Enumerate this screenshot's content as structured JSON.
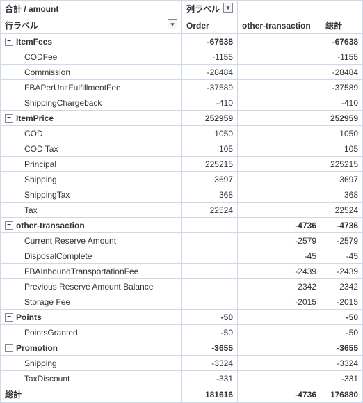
{
  "header": {
    "topLeft": "合計 / amount",
    "colLabelsTitle": "列ラベル",
    "rowLabelsTitle": "行ラベル",
    "col1": "Order",
    "col2": "other-transaction",
    "col3": "総計"
  },
  "groups": [
    {
      "label": "ItemFees",
      "order": "-67638",
      "other": "",
      "total": "-67638",
      "children": [
        {
          "label": "CODFee",
          "order": "-1155",
          "other": "",
          "total": "-1155"
        },
        {
          "label": "Commission",
          "order": "-28484",
          "other": "",
          "total": "-28484"
        },
        {
          "label": "FBAPerUnitFulfillmentFee",
          "order": "-37589",
          "other": "",
          "total": "-37589"
        },
        {
          "label": "ShippingChargeback",
          "order": "-410",
          "other": "",
          "total": "-410"
        }
      ]
    },
    {
      "label": "ItemPrice",
      "order": "252959",
      "other": "",
      "total": "252959",
      "children": [
        {
          "label": "COD",
          "order": "1050",
          "other": "",
          "total": "1050"
        },
        {
          "label": "COD Tax",
          "order": "105",
          "other": "",
          "total": "105"
        },
        {
          "label": "Principal",
          "order": "225215",
          "other": "",
          "total": "225215"
        },
        {
          "label": "Shipping",
          "order": "3697",
          "other": "",
          "total": "3697"
        },
        {
          "label": "ShippingTax",
          "order": "368",
          "other": "",
          "total": "368"
        },
        {
          "label": "Tax",
          "order": "22524",
          "other": "",
          "total": "22524"
        }
      ]
    },
    {
      "label": "other-transaction",
      "order": "",
      "other": "-4736",
      "total": "-4736",
      "children": [
        {
          "label": "Current Reserve Amount",
          "order": "",
          "other": "-2579",
          "total": "-2579"
        },
        {
          "label": "DisposalComplete",
          "order": "",
          "other": "-45",
          "total": "-45"
        },
        {
          "label": "FBAInboundTransportationFee",
          "order": "",
          "other": "-2439",
          "total": "-2439"
        },
        {
          "label": "Previous Reserve Amount Balance",
          "order": "",
          "other": "2342",
          "total": "2342"
        },
        {
          "label": "Storage Fee",
          "order": "",
          "other": "-2015",
          "total": "-2015"
        }
      ]
    },
    {
      "label": "Points",
      "order": "-50",
      "other": "",
      "total": "-50",
      "children": [
        {
          "label": "PointsGranted",
          "order": "-50",
          "other": "",
          "total": "-50"
        }
      ]
    },
    {
      "label": "Promotion",
      "order": "-3655",
      "other": "",
      "total": "-3655",
      "children": [
        {
          "label": "Shipping",
          "order": "-3324",
          "other": "",
          "total": "-3324"
        },
        {
          "label": "TaxDiscount",
          "order": "-331",
          "other": "",
          "total": "-331"
        }
      ]
    }
  ],
  "grandTotal": {
    "label": "総計",
    "order": "181616",
    "other": "-4736",
    "total": "176880"
  }
}
